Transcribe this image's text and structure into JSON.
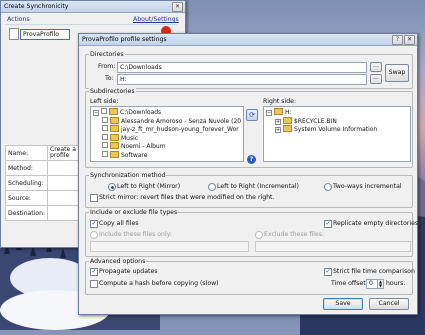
{
  "bg_window": {
    "title": "Create Synchronicity",
    "actions_label": "Actions",
    "about_label": "About/Settings",
    "profile_name": "ProvaProfilo",
    "table": {
      "name_label": "Name:",
      "name_value": "Create a profile",
      "method_label": "Method:",
      "scheduling_label": "Scheduling:",
      "source_label": "Source:",
      "destination_label": "Destination:"
    }
  },
  "dialog": {
    "title": "ProvaProfilo profile settings",
    "help_glyph": "?",
    "close_glyph": "✕",
    "directories": {
      "section": "Directories",
      "from_label": "From:",
      "from_value": "C:\\Downloads",
      "to_label": "To:",
      "to_value": "H:",
      "browse_label": "...",
      "swap_label": "Swap"
    },
    "subdirectories": {
      "section": "Subdirectories",
      "left_label": "Left side:",
      "right_label": "Right side:",
      "left_tree": [
        {
          "label": "C:\\Downloads",
          "indent": 0,
          "root": true
        },
        {
          "label": "Alessandre Amoroso - Senza Nuvole (20",
          "indent": 1
        },
        {
          "label": "jay-z_ft_mr_hudson-young_forever_Wor",
          "indent": 1
        },
        {
          "label": "Music",
          "indent": 1
        },
        {
          "label": "Noemi - Album",
          "indent": 1
        },
        {
          "label": "Software",
          "indent": 1
        }
      ],
      "right_tree": [
        {
          "label": "H:",
          "indent": 0,
          "root": true
        },
        {
          "label": "$RECYCLE.BIN",
          "indent": 1
        },
        {
          "label": "System Volume Information",
          "indent": 1
        }
      ],
      "help_glyph": "?"
    },
    "sync_method": {
      "section": "Synchronization method",
      "options": [
        "Left to Right (Mirror)",
        "Left to Right (Incremental)",
        "Two-ways incremental"
      ],
      "selected": 0,
      "strict_mirror": "Strict mirror: revert files that were modified on the right."
    },
    "include": {
      "section": "Include or exclude file types",
      "copy_all": "Copy all files",
      "replicate_empty": "Replicate empty directories",
      "include_only": "Include these files only:",
      "exclude": "Exclude these files:"
    },
    "advanced": {
      "section": "Advanced options",
      "propagate": "Propagate updates",
      "strict_time": "Strict file time comparison",
      "hash": "Compute a hash before copying (slow)",
      "offset_label": "Time offset:",
      "offset_value": "0",
      "hours_label": "hours."
    },
    "save_label": "Save",
    "cancel_label": "Cancel"
  }
}
